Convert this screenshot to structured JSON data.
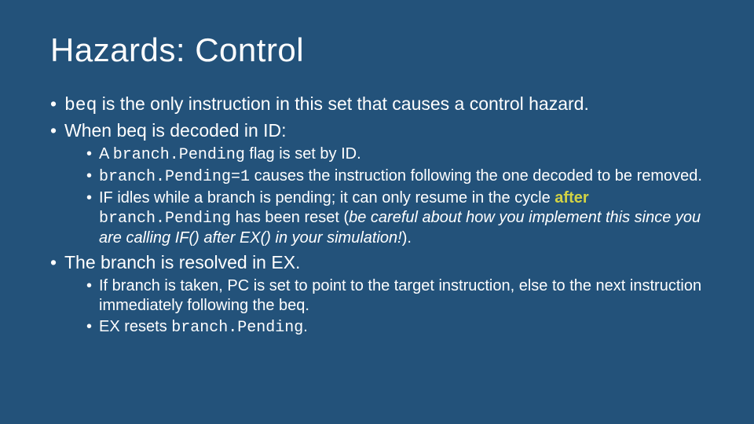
{
  "title": "Hazards: Control",
  "b1": {
    "pre": "",
    "code": "beq",
    "post": " is the only instruction in this set that causes a control hazard."
  },
  "b2": "When beq is decoded in ID:",
  "b2a": {
    "pre": "A ",
    "code": "branch.Pending",
    "post": " flag is set by ID."
  },
  "b2b": {
    "code": "branch.Pending=1",
    "post": " causes the instruction following the one decoded to be removed."
  },
  "b2c": {
    "pre": "IF idles while a branch is pending; it can only resume in the cycle ",
    "accent": "after",
    "mid": " ",
    "code": "branch.Pending",
    "post": " has been reset (",
    "ital": "be careful about how you implement this since you are calling IF() after EX() in your simulation!",
    "close": ")."
  },
  "b3": "The branch is resolved in EX.",
  "b3a": "If branch is taken, PC is set to point to the target instruction, else to the next instruction immediately following the beq.",
  "b3b": {
    "pre": "EX resets ",
    "code": "branch.Pending",
    "post": "."
  }
}
